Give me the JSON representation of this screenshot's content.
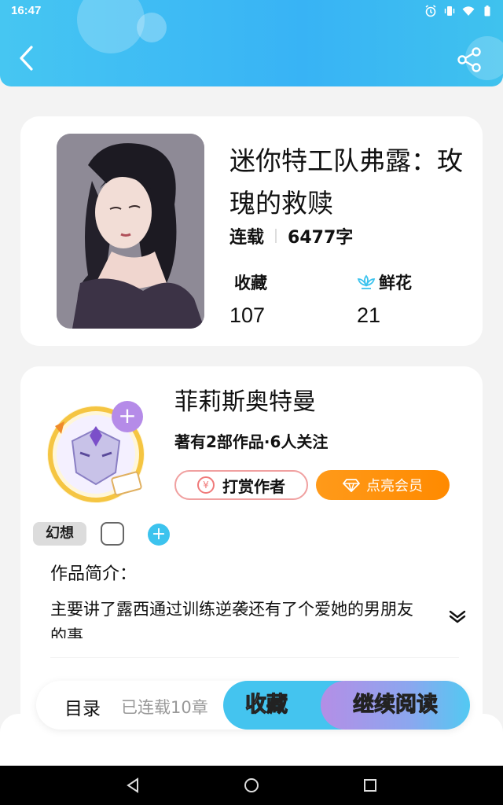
{
  "status_bar": {
    "time": "16:47",
    "icons": [
      "alarm-icon",
      "vibrate-icon",
      "wifi-icon",
      "battery-icon"
    ]
  },
  "header": {
    "back_icon": "chevron-left-icon",
    "share_icon": "share-icon",
    "background_color": "#3cbaf4"
  },
  "book": {
    "title": "迷你特工队弗露：玫瑰的救赎",
    "status": "连载",
    "word_count": "6477字",
    "favorites_label": "收藏",
    "favorites_count": "107",
    "flowers_label": "鲜花",
    "flowers_count": "21",
    "flower_icon": "lotus-flower-icon"
  },
  "author": {
    "name": "菲莉斯奥特曼",
    "stats": "著有2部作品·6人关注",
    "tip_button": "打赏作者",
    "tip_icon": "yen-coin-icon",
    "vip_button": "点亮会员",
    "vip_icon": "diamond-icon",
    "follow_icon": "plus-icon"
  },
  "tags": {
    "items": [
      "幻想"
    ],
    "add_icon": "plus-icon"
  },
  "intro": {
    "label": "作品简介：",
    "text": "主要讲了露西通过训练逆袭还有了个爱她的男朋友的事",
    "expand_icon": "double-chevron-down-icon"
  },
  "action_bar": {
    "toc_label": "目录",
    "chapters_label": "已连载10章",
    "favorite_button": "收藏",
    "read_button": "继续阅读"
  },
  "nav_bar": {
    "back_icon": "triangle-back-icon",
    "home_icon": "circle-home-icon",
    "recents_icon": "square-recents-icon"
  },
  "colors": {
    "accent_blue": "#44c4ef",
    "vip_orange": "#ff8a00",
    "tip_red": "#f07a7a",
    "read_purple": "#b48ee6"
  }
}
